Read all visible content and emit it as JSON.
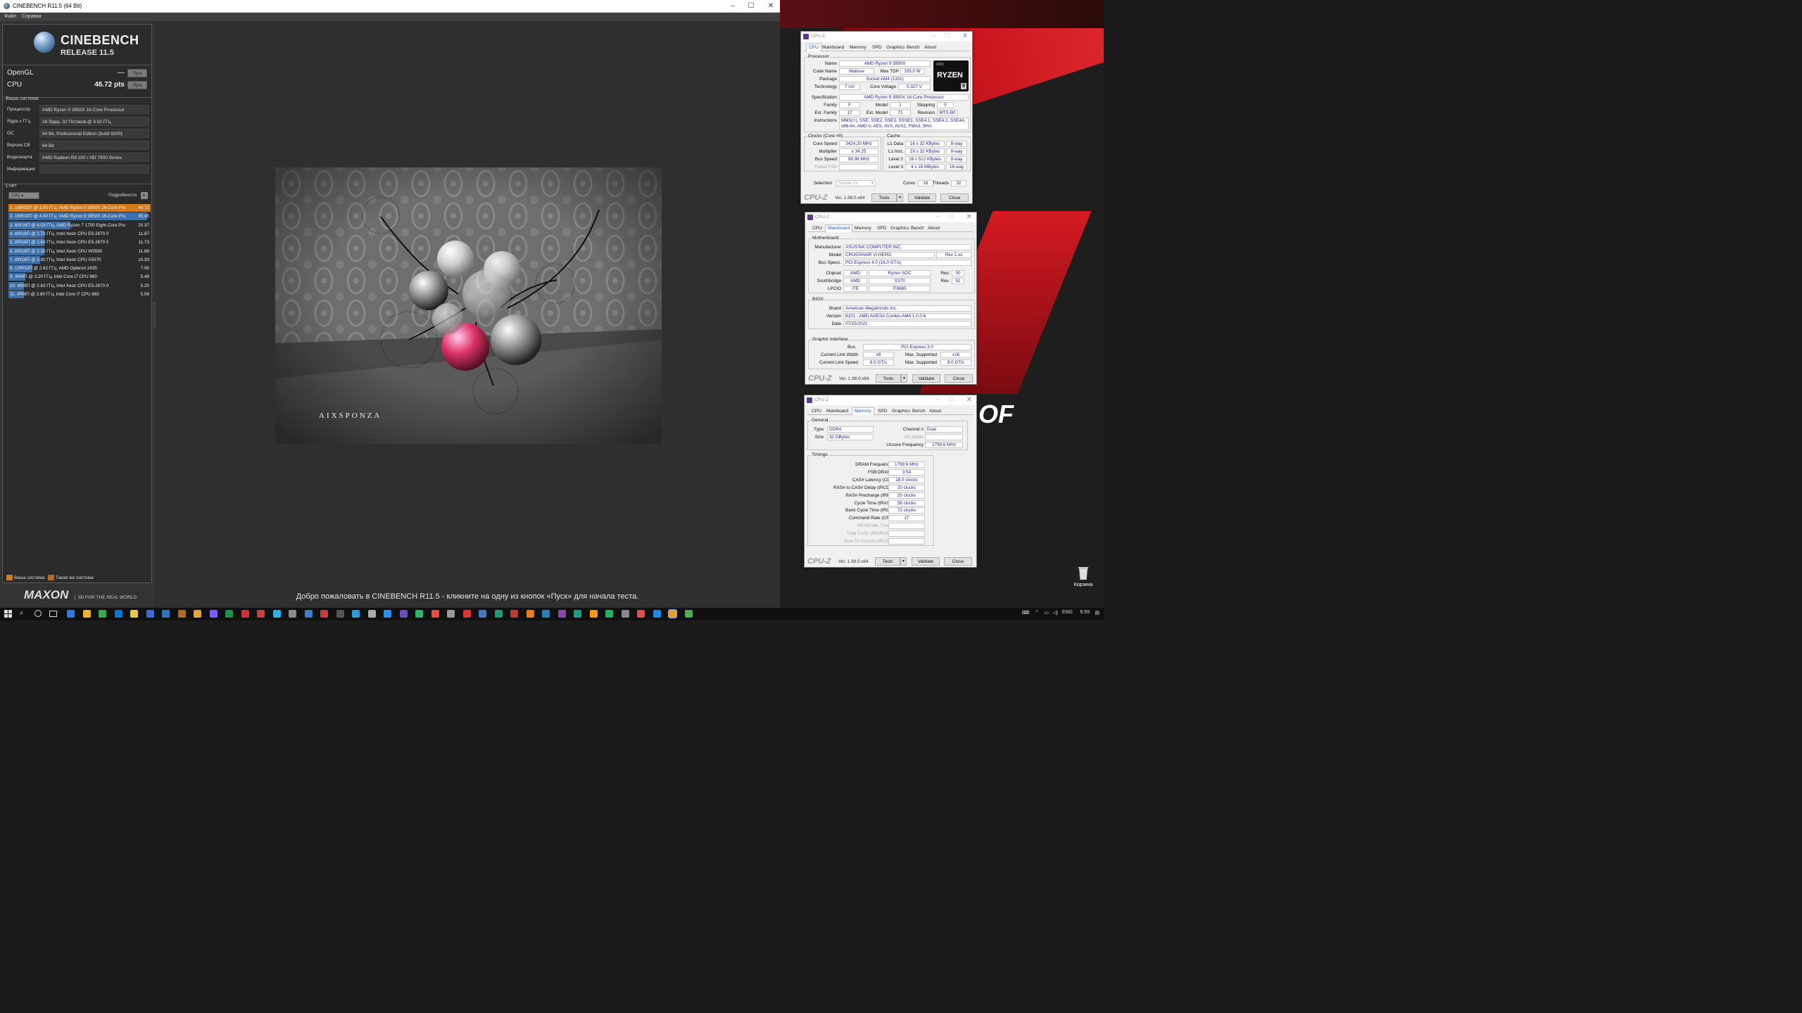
{
  "cinebench": {
    "window_title": "CINEBENCH R11.5 (64 Bit)",
    "menu": [
      "Файл",
      "Справка"
    ],
    "logo_line1": "CINEBENCH",
    "logo_line2": "RELEASE 11.5",
    "opengl_label": "OpenGL",
    "opengl_value": "—",
    "cpu_label": "CPU",
    "cpu_value": "46.72 pts",
    "run_button": "Пуск",
    "system_section": "Ваша система",
    "system_rows": [
      {
        "key": "Процессор",
        "value": "AMD Ryzen 9 3950X 16-Core Processor"
      },
      {
        "key": "Ядра x ГГц",
        "value": "16 Ядер, 32 Потоков @ 3.50 ГГц"
      },
      {
        "key": "ОС",
        "value": "64 Bit, Professional Edition (build 9200)"
      },
      {
        "key": "Версия CB",
        "value": "64 Bit"
      },
      {
        "key": "Видеокарта",
        "value": "AMD Radeon R9 200 / HD 7900 Series"
      },
      {
        "key": "Информация",
        "value": ""
      }
    ],
    "score_section": "Счёт",
    "score_select": "CPU",
    "details_label": "Подробности",
    "ranking": [
      {
        "text": "1. 16Я/32П @ 3.50 ГГц, AMD Ryzen 9 3950X 16-Core Pro",
        "score": "46.72",
        "frac": 1.0
      },
      {
        "text": "2. 16Я/32П @ 4.00 ГГц, AMD Ryzen 9 3950X 16-Core Pro",
        "score": "45.45",
        "frac": 0.973
      },
      {
        "text": "3. 8Я/16П @ 4.03 ГГц, AMD Ryzen 7 1700 Eight-Core Pro",
        "score": "20.37",
        "frac": 0.436
      },
      {
        "text": "4. 8Я/16П @ 2.73 ГГц,  Intel Xeon CPU E5-2670 0",
        "score": "11.87",
        "frac": 0.254
      },
      {
        "text": "5. 8Я/16П @ 2.63 ГГц,  Intel Xeon CPU E5-2670 0",
        "score": "11.73",
        "frac": 0.251
      },
      {
        "text": "6. 8Я/16П @ 3.33 ГГц, Intel Xeon CPU W5590",
        "score": "11.69",
        "frac": 0.25
      },
      {
        "text": "7. 8Я/16П @ 2.92 ГГц, Intel Xeon CPU X5570",
        "score": "10.33",
        "frac": 0.221
      },
      {
        "text": "8. 12Я/12П @ 2.62 ГГц, AMD Opteron 2435",
        "score": "7.95",
        "frac": 0.17
      },
      {
        "text": "9. 4Я/8П @ 3.20 ГГц, Intel Core i7 CPU 960",
        "score": "5.48",
        "frac": 0.117
      },
      {
        "text": "10. 4Я/8П @ 2.63 ГГц, Intel Xeon CPU E5-2670 0",
        "score": "5.20",
        "frac": 0.111
      },
      {
        "text": "11. 4Я/8П @ 2.80 ГГц, Intel Core i7 CPU 860",
        "score": "5.06",
        "frac": 0.108
      }
    ],
    "legend_yours": "Ваша система",
    "legend_same": "Такая же система",
    "maxon": "MAXON",
    "maxon_tag": "3D FOR THE REAL WORLD",
    "render_watermark": "AIXSPONZA",
    "status": "Добро пожаловать в CINEBENCH R11.5 - кликните на одну из кнопок «Пуск» для начала теста."
  },
  "cpuz_common": {
    "title": "CPU-Z",
    "tabs": [
      "CPU",
      "Mainboard",
      "Memory",
      "SPD",
      "Graphics",
      "Bench",
      "About"
    ],
    "logo": "CPU-Z",
    "version": "Ver. 1.98.0.x64",
    "tools": "Tools",
    "validate": "Validate",
    "close": "Close"
  },
  "cpuz_cpu": {
    "processor_group": "Processor",
    "name_label": "Name",
    "name": "AMD Ryzen 9 3950X",
    "codename_label": "Code Name",
    "codename": "Matisse",
    "maxtdp_label": "Max TDP",
    "maxtdp": "105.0 W",
    "package_label": "Package",
    "package": "Socket AM4 (1331)",
    "technology_label": "Technology",
    "technology": "7 nm",
    "corevoltage_label": "Core Voltage",
    "corevoltage": "0.327 V",
    "spec_label": "Specification",
    "spec": "AMD Ryzen 9 3950X 16-Core Processor",
    "family_label": "Family",
    "family": "F",
    "model_label": "Model",
    "model": "1",
    "stepping_label": "Stepping",
    "stepping": "0",
    "extfamily_label": "Ext. Family",
    "extfamily": "17",
    "extmodel_label": "Ext. Model",
    "extmodel": "71",
    "revision_label": "Revision",
    "revision": "MTS-B0",
    "instr_label": "Instructions",
    "instr1": "MMX(+), SSE, SSE2, SSE3, SSSE3, SSE4.1, SSE4.2, SSE4A,",
    "instr2": "x86-64, AMD-V, AES, AVX, AVX2, FMA3, SHA",
    "clocks_group": "Clocks (Core #0)",
    "corespeed_label": "Core Speed",
    "corespeed": "3424.20 MHz",
    "multiplier_label": "Multiplier",
    "multiplier": "x 34.25",
    "busspeed_label": "Bus Speed",
    "busspeed": "99.98 MHz",
    "ratedfsb_label": "Rated FSB",
    "cache_group": "Cache",
    "l1data_label": "L1 Data",
    "l1data": "16 x 32 KBytes",
    "l1data_way": "8-way",
    "l1inst_label": "L1 Inst.",
    "l1inst": "16 x 32 KBytes",
    "l1inst_way": "8-way",
    "l2_label": "Level 2",
    "l2": "16 x 512 KBytes",
    "l2_way": "8-way",
    "l3_label": "Level 3",
    "l3": "4 x 16 MBytes",
    "l3_way": "16-way",
    "selection_label": "Selection",
    "selection": "Socket #1",
    "cores_label": "Cores",
    "cores": "16",
    "threads_label": "Threads",
    "threads": "32",
    "badge_line1": "AMD",
    "badge_line2": "RYZEN",
    "badge_line3": "9"
  },
  "cpuz_mb": {
    "mb_group": "Motherboard",
    "manufacturer_label": "Manufacturer",
    "manufacturer": "ASUSTeK COMPUTER INC.",
    "model_label": "Model",
    "model": "CROSSHAIR VI HERO",
    "model_rev": "Rev 1.xx",
    "busspecs_label": "Bus Specs.",
    "busspecs": "PCI-Express 4.0 (16.0 GT/s)",
    "chipset_label": "Chipset",
    "chipset_vendor": "AMD",
    "chipset": "Ryzen SOC",
    "rev_label": "Rev.",
    "chipset_rev": "00",
    "southbridge_label": "Southbridge",
    "sb_vendor": "AMD",
    "sb": "X370",
    "sb_rev": "51",
    "lpcio_label": "LPCIO",
    "lpcio_vendor": "ITE",
    "lpcio": "IT8665",
    "bios_group": "BIOS",
    "brand_label": "Brand",
    "brand": "American Megatrends Inc.",
    "version_label": "Version",
    "version": "8101 - AMD AGESA Combo-AM4 1.0.0.6",
    "date_label": "Date",
    "date": "07/15/2021",
    "gi_group": "Graphic Interface",
    "bus_label": "Bus",
    "bus": "PCI-Express 3.0",
    "clw_label": "Current Link Width",
    "clw": "x8",
    "maxsup_label": "Max. Supported",
    "maxsup_w": "x16",
    "cls_label": "Current Link Speed",
    "cls": "8.0 GT/s",
    "maxsup_s": "8.0 GT/s"
  },
  "cpuz_mem": {
    "general_group": "General",
    "type_label": "Type",
    "type": "DDR4",
    "channel_label": "Channel #",
    "channel": "Dual",
    "dcmode_label": "DC Mode",
    "size_label": "Size",
    "size": "32 GBytes",
    "uncore_label": "Uncore Frequency",
    "uncore": "1799.6 MHz",
    "timings_group": "Timings",
    "timings": [
      {
        "label": "DRAM Frequency",
        "value": "1799.6 MHz",
        "dis": false
      },
      {
        "label": "FSB:DRAM",
        "value": "3:54",
        "dis": false
      },
      {
        "label": "CAS# Latency (CL)",
        "value": "18.0 clocks",
        "dis": false
      },
      {
        "label": "RAS# to CAS# Delay (tRCD)",
        "value": "20 clocks",
        "dis": false
      },
      {
        "label": "RAS# Precharge (tRP)",
        "value": "20 clocks",
        "dis": false
      },
      {
        "label": "Cycle Time (tRAS)",
        "value": "56 clocks",
        "dis": false
      },
      {
        "label": "Bank Cycle Time (tRC)",
        "value": "72 clocks",
        "dis": false
      },
      {
        "label": "Command Rate (CR)",
        "value": "1T",
        "dis": false
      },
      {
        "label": "DRAM Idle Timer",
        "value": "",
        "dis": true
      },
      {
        "label": "Total CAS# (tRDRAM)",
        "value": "",
        "dis": true
      },
      {
        "label": "Row To Column (tRCD)",
        "value": "",
        "dis": true
      }
    ]
  },
  "desktop": {
    "recycle_label": "Корзина",
    "rog_text": "OF"
  },
  "taskbar": {
    "lang": "ENG",
    "time": "6:59"
  }
}
